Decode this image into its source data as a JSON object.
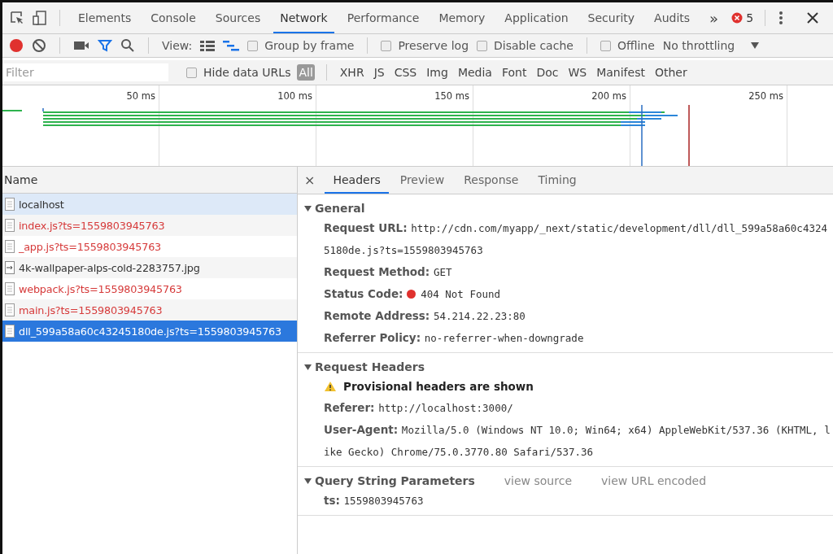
{
  "main_tabs": [
    {
      "label": "Elements",
      "selected": false
    },
    {
      "label": "Console",
      "selected": false
    },
    {
      "label": "Sources",
      "selected": false
    },
    {
      "label": "Network",
      "selected": true
    },
    {
      "label": "Performance",
      "selected": false
    },
    {
      "label": "Memory",
      "selected": false
    },
    {
      "label": "Application",
      "selected": false
    },
    {
      "label": "Security",
      "selected": false
    },
    {
      "label": "Audits",
      "selected": false
    }
  ],
  "more_tabs": "»",
  "error_count": "5",
  "toolbar": {
    "recording": true,
    "filter_on": true,
    "view_label": "View:",
    "large_rows": false,
    "waterfall_on": true,
    "checkboxes": [
      {
        "label": "Group by frame",
        "checked": false
      },
      {
        "label": "Preserve log",
        "checked": false
      },
      {
        "label": "Disable cache",
        "checked": false
      },
      {
        "label": "Offline",
        "checked": false
      }
    ],
    "throttling": "No throttling"
  },
  "filter_bar": {
    "placeholder": "Filter",
    "hide_data_urls": {
      "label": "Hide data URLs",
      "checked": false
    },
    "types": [
      {
        "label": "All",
        "selected": true
      },
      {
        "label": "XHR",
        "selected": false
      },
      {
        "label": "JS",
        "selected": false
      },
      {
        "label": "CSS",
        "selected": false
      },
      {
        "label": "Img",
        "selected": false
      },
      {
        "label": "Media",
        "selected": false
      },
      {
        "label": "Font",
        "selected": false
      },
      {
        "label": "Doc",
        "selected": false
      },
      {
        "label": "WS",
        "selected": false
      },
      {
        "label": "Manifest",
        "selected": false
      },
      {
        "label": "Other",
        "selected": false
      }
    ]
  },
  "overview": {
    "ticks": [
      "50 ms",
      "100 ms",
      "150 ms",
      "200 ms",
      "250 ms"
    ]
  },
  "requests": {
    "column": "Name",
    "rows": [
      {
        "name": "localhost",
        "kind": "document",
        "error": false,
        "hovered": true,
        "selected": false
      },
      {
        "name": "index.js?ts=1559803945763",
        "kind": "document",
        "error": true,
        "hovered": false,
        "selected": false
      },
      {
        "name": "_app.js?ts=1559803945763",
        "kind": "document",
        "error": true,
        "hovered": false,
        "selected": false
      },
      {
        "name": "4k-wallpaper-alps-cold-2283757.jpg",
        "kind": "image",
        "error": false,
        "hovered": false,
        "selected": false
      },
      {
        "name": "webpack.js?ts=1559803945763",
        "kind": "document",
        "error": true,
        "hovered": false,
        "selected": false
      },
      {
        "name": "main.js?ts=1559803945763",
        "kind": "document",
        "error": true,
        "hovered": false,
        "selected": false
      },
      {
        "name": "dll_599a58a60c43245180de.js?ts=1559803945763",
        "kind": "document",
        "error": true,
        "hovered": false,
        "selected": true
      }
    ]
  },
  "detail": {
    "close": "×",
    "tabs": [
      {
        "label": "Headers",
        "selected": true
      },
      {
        "label": "Preview",
        "selected": false
      },
      {
        "label": "Response",
        "selected": false
      },
      {
        "label": "Timing",
        "selected": false
      }
    ],
    "sections": [
      {
        "title": "General",
        "expanded": true,
        "rows": [
          {
            "kind": "pair",
            "key": "Request URL:",
            "value": "http://cdn.com/myapp/_next/static/development/dll/dll_599a58a60c43245180de.js?ts=1559803945763"
          },
          {
            "kind": "pair",
            "key": "Request Method:",
            "value": "GET"
          },
          {
            "kind": "status",
            "key": "Status Code:",
            "value": "404 Not Found",
            "color": "#e0312e"
          },
          {
            "kind": "pair",
            "key": "Remote Address:",
            "value": "54.214.22.23:80"
          },
          {
            "kind": "pair",
            "key": "Referrer Policy:",
            "value": "no-referrer-when-downgrade"
          }
        ]
      },
      {
        "title": "Request Headers",
        "expanded": true,
        "rows": [
          {
            "kind": "warning",
            "value": "Provisional headers are shown"
          },
          {
            "kind": "pair",
            "key": "Referer:",
            "value": "http://localhost:3000/"
          },
          {
            "kind": "pair",
            "key": "User-Agent:",
            "value": "Mozilla/5.0 (Windows NT 10.0; Win64; x64) AppleWebKit/537.36 (KHTML, like Gecko) Chrome/75.0.3770.80 Safari/537.36"
          }
        ]
      },
      {
        "title": "Query String Parameters",
        "expanded": true,
        "links": [
          "view source",
          "view URL encoded"
        ],
        "rows": [
          {
            "kind": "pair",
            "key": "ts:",
            "value": "1559803945763"
          }
        ]
      }
    ]
  }
}
